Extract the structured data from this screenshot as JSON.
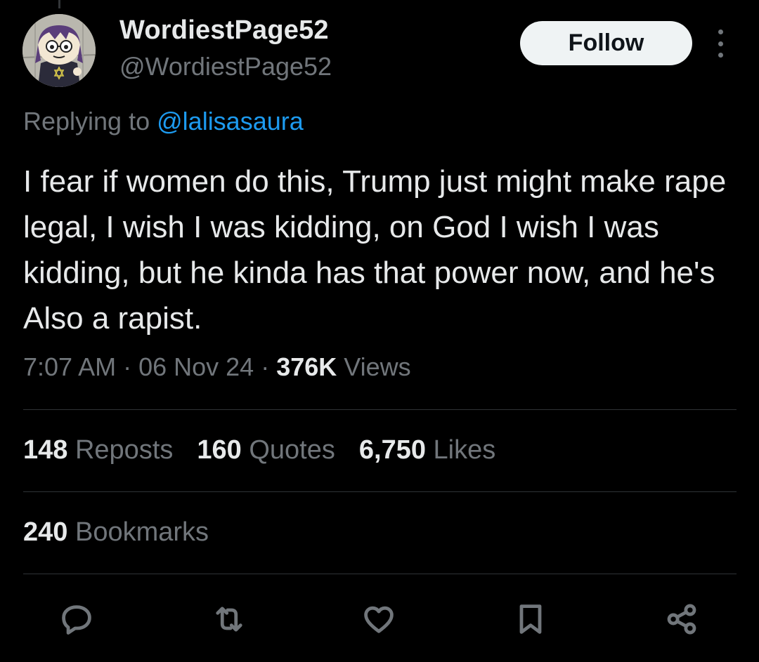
{
  "author": {
    "display_name": "WordiestPage52",
    "handle": "@WordiestPage52",
    "avatar_icon": "cartoon-character-avatar"
  },
  "follow_label": "Follow",
  "more_icon": "more-vertical-icon",
  "reply": {
    "prefix": "Replying to",
    "to": "@lalisasaura"
  },
  "tweet_text": "I fear if women do this, Trump just might make rape legal, I wish I was kidding, on God I wish I was kidding, but he kinda has that power now, and he's Also a rapist.",
  "meta": {
    "time": "7:07 AM",
    "sep1": " · ",
    "date": "06 Nov 24",
    "sep2": " · ",
    "views_count": "376K",
    "views_label": "Views"
  },
  "stats": {
    "reposts_count": "148",
    "reposts_label": "Reposts",
    "quotes_count": "160",
    "quotes_label": "Quotes",
    "likes_count": "6,750",
    "likes_label": "Likes",
    "bookmarks_count": "240",
    "bookmarks_label": "Bookmarks"
  },
  "actions": [
    "reply-icon",
    "repost-icon",
    "like-icon",
    "bookmark-icon",
    "share-icon"
  ],
  "colors": {
    "background": "#000000",
    "text": "#e7e9ea",
    "muted": "#71767b",
    "link": "#1d9bf0",
    "divider": "#2f3336"
  }
}
